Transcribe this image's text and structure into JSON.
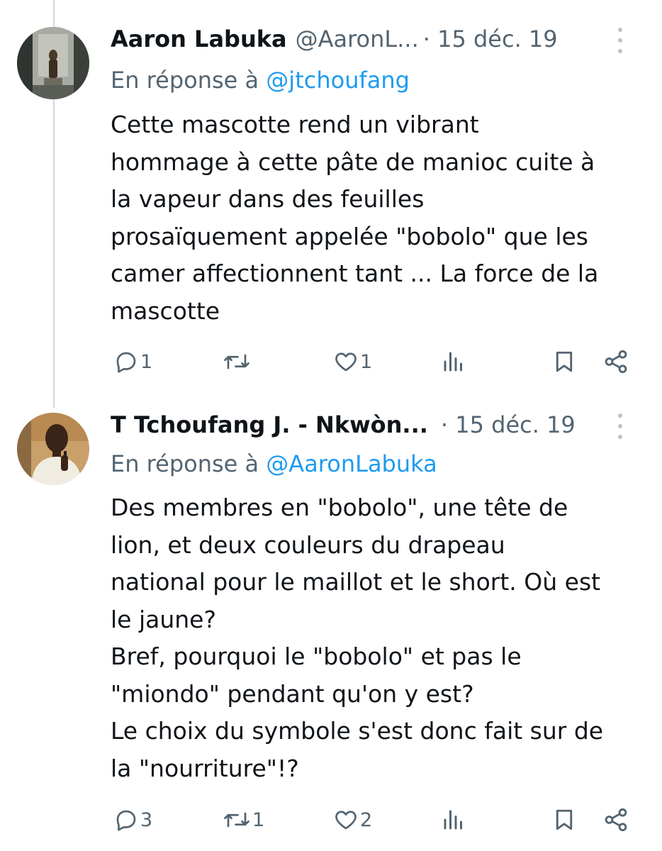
{
  "tweets": [
    {
      "name": "Aaron Labuka",
      "handle": "@AaronL...",
      "date": "· 15 déc. 19",
      "reply_prefix": "En réponse à ",
      "reply_mention": "@jtchoufang",
      "body_lines": [
        "Cette mascotte rend un vibrant",
        "hommage à cette pâte de manioc cuite à",
        "la vapeur dans des feuilles",
        "prosaïquement appelée \"bobolo\" que les",
        "camer affectionnent tant ... La force de la",
        "mascotte"
      ],
      "replies": "1",
      "retweets": "",
      "likes": "1"
    },
    {
      "name": "T Tchoufang J. - Nkwòn...",
      "handle": "",
      "date": "· 15 déc. 19",
      "reply_prefix": "En réponse à ",
      "reply_mention": "@AaronLabuka",
      "body_lines": [
        "Des membres en \"bobolo\", une tête de",
        "lion, et deux couleurs du drapeau",
        "national pour le maillot et le short. Où est",
        "le jaune?",
        "Bref, pourquoi le \"bobolo\" et pas le",
        "\"miondo\" pendant qu'on y est?",
        "Le choix du symbole s'est donc fait sur de",
        "la \"nourriture\"!?"
      ],
      "replies": "3",
      "retweets": "1",
      "likes": "2"
    }
  ],
  "icons": {
    "reply": "reply-icon",
    "retweet": "retweet-icon",
    "like": "heart-icon",
    "views": "views-icon",
    "bookmark": "bookmark-icon",
    "share": "share-icon",
    "more": "more-vertical-icon"
  },
  "colors": {
    "text": "#0f1419",
    "secondary": "#536471",
    "link": "#1d9bf0",
    "thread_line": "#cfd9de"
  }
}
